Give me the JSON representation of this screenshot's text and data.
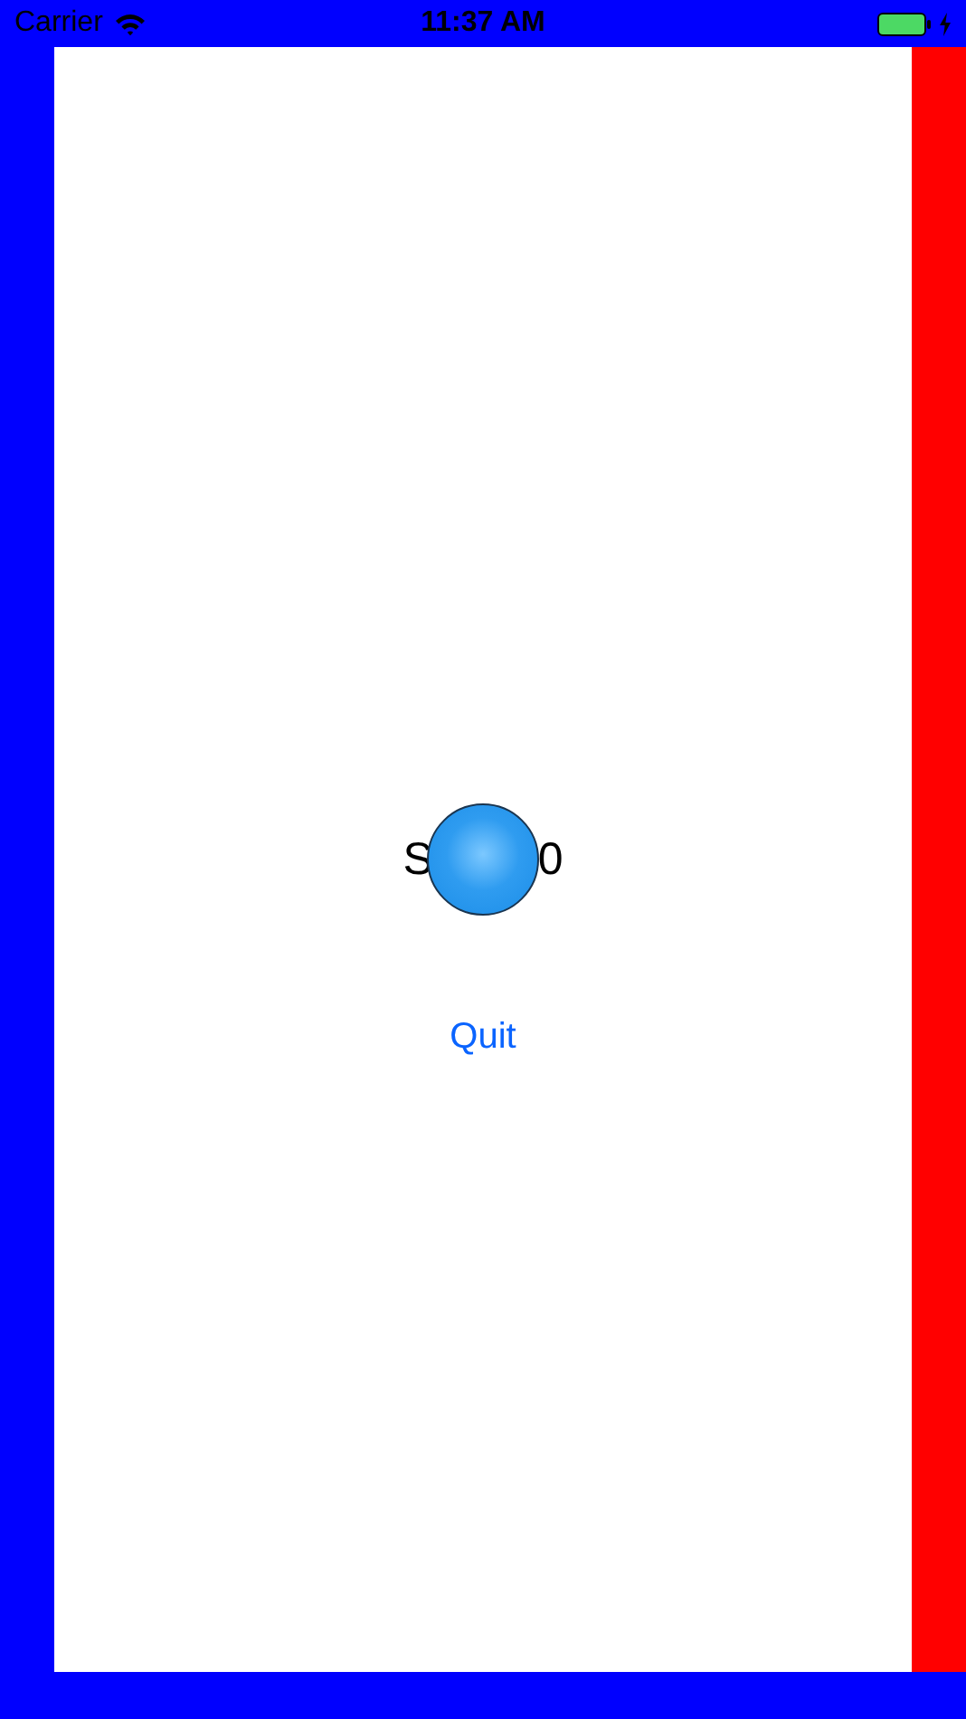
{
  "status_bar": {
    "carrier": "Carrier",
    "time": "11:37 AM"
  },
  "score": {
    "visible_start": "S",
    "visible_end": "0"
  },
  "quit_button": "Quit"
}
